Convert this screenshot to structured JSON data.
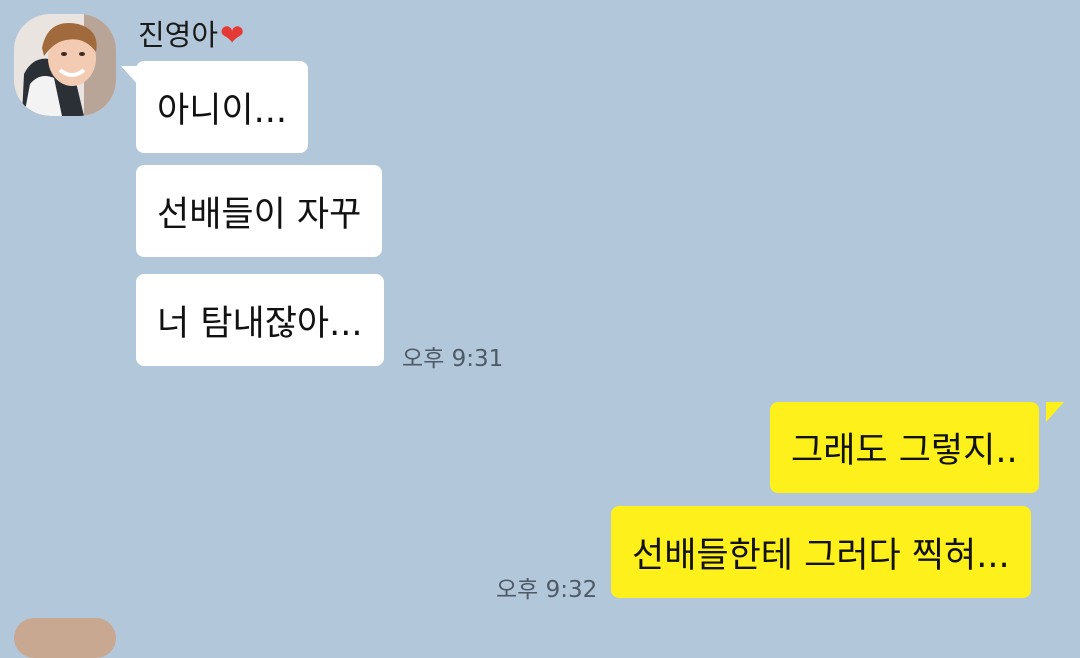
{
  "sender": {
    "name": "진영아",
    "name_icon": "heart-icon"
  },
  "messages": {
    "incoming": [
      "아니이...",
      "선배들이 자꾸",
      "너 탐내잖아..."
    ],
    "incoming_time": "오후 9:31",
    "outgoing": [
      "그래도 그렇지..",
      "선배들한테 그러다 찍혀..."
    ],
    "outgoing_time": "오후 9:32"
  },
  "colors": {
    "background": "#b2c7da",
    "incoming_bubble": "#ffffff",
    "outgoing_bubble": "#fef01b",
    "heart": "#e53935"
  }
}
